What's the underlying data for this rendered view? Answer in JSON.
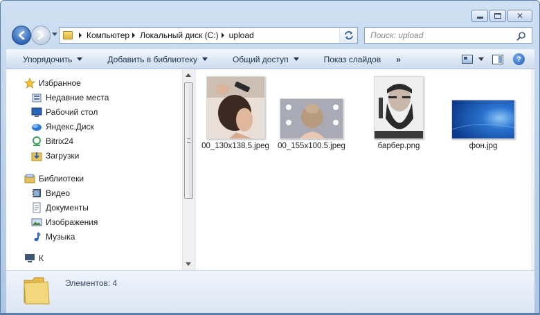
{
  "window": {
    "caption_buttons": [
      "minimize",
      "maximize",
      "close"
    ]
  },
  "navigation": {
    "back_icon": "back-arrow-icon",
    "forward_icon": "forward-arrow-icon",
    "breadcrumb": [
      "Компьютер",
      "Локальный диск (C:)",
      "upload"
    ],
    "search_placeholder": "Поиск: upload"
  },
  "toolbar": {
    "organize": "Упорядочить",
    "add_to_library": "Добавить в библиотеку",
    "share": "Общий доступ",
    "slideshow": "Показ слайдов",
    "more": "»",
    "help": "?"
  },
  "sidebar": {
    "favorites": {
      "label": "Избранное",
      "items": [
        {
          "label": "Недавние места",
          "icon": "recent-places-icon"
        },
        {
          "label": "Рабочий стол",
          "icon": "desktop-icon"
        },
        {
          "label": "Яндекс.Диск",
          "icon": "yandex-disk-icon"
        },
        {
          "label": "Bitrix24",
          "icon": "bitrix24-icon"
        },
        {
          "label": "Загрузки",
          "icon": "downloads-icon"
        }
      ]
    },
    "libraries": {
      "label": "Библиотеки",
      "items": [
        {
          "label": "Видео",
          "icon": "video-icon"
        },
        {
          "label": "Документы",
          "icon": "documents-icon"
        },
        {
          "label": "Изображения",
          "icon": "pictures-icon"
        },
        {
          "label": "Музыка",
          "icon": "music-icon"
        }
      ]
    },
    "computer_partial": "К"
  },
  "files": [
    {
      "name": "00_130x138.5.jpeg",
      "thumbnail": "hair-styling-photo"
    },
    {
      "name": "00_155x100.5.jpeg",
      "thumbnail": "hairstyle-back-photo"
    },
    {
      "name": "барбер.png",
      "thumbnail": "bearded-man-photo"
    },
    {
      "name": "фон.jpg",
      "thumbnail": "blue-wallpaper"
    }
  ],
  "details": {
    "count_text": "Элементов: 4"
  },
  "colors": {
    "frame": "#b9cfe8",
    "toolbar_text": "#1e3250",
    "wallpaper_blue": "#1f5fbf"
  }
}
